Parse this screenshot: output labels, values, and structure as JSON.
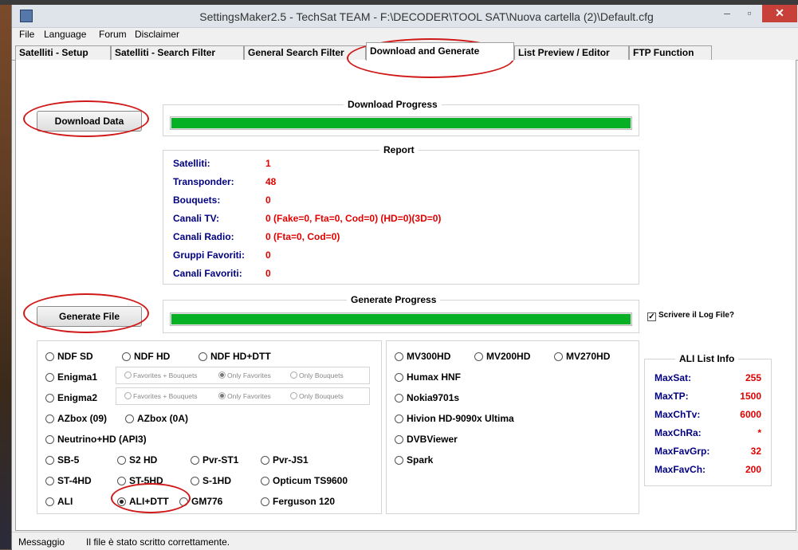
{
  "window": {
    "title": "SettingsMaker2.5 - TechSat TEAM - F:\\DECODER\\TOOL SAT\\Nuova cartella (2)\\Default.cfg",
    "minimize": "–",
    "maximize": "▫",
    "close": "✕"
  },
  "menu": [
    "File",
    "Language",
    "Forum",
    "Disclaimer"
  ],
  "tabs": [
    "Satelliti - Setup",
    "Satelliti - Search Filter",
    "General Search Filter",
    "Download and Generate",
    "List Preview / Editor",
    "FTP Function"
  ],
  "download": {
    "button": "Download Data",
    "progress_title": "Download Progress",
    "progress": 1.0
  },
  "report": {
    "title": "Report",
    "rows": [
      {
        "label": "Satelliti:",
        "value": "1"
      },
      {
        "label": "Transponder:",
        "value": "48"
      },
      {
        "label": "Bouquets:",
        "value": "0"
      },
      {
        "label": "Canali TV:",
        "value": "0 (Fake=0, Fta=0, Cod=0) (HD=0)(3D=0)"
      },
      {
        "label": "Canali Radio:",
        "value": "0 (Fta=0, Cod=0)"
      },
      {
        "label": "Gruppi Favoriti:",
        "value": "0"
      },
      {
        "label": "Canali Favoriti:",
        "value": "0"
      }
    ]
  },
  "generate": {
    "button": "Generate File",
    "progress_title": "Generate Progress",
    "progress": 1.0,
    "log_checkbox": "Scrivere il Log File?",
    "log_checked": "✓"
  },
  "formats": {
    "ndf_sd": "NDF SD",
    "ndf_hd": "NDF HD",
    "ndf_hd_dtt": "NDF HD+DTT",
    "enigma1": "Enigma1",
    "enigma2": "Enigma2",
    "sub_options": [
      "Favorites + Bouquets",
      "Only Favorites",
      "Only Bouquets"
    ],
    "azbox09": "AZbox (09)",
    "azbox0a": "AZbox (0A)",
    "neutrino": "Neutrino+HD (API3)",
    "sb5": "SB-5",
    "s2hd": "S2 HD",
    "pvrst1": "Pvr-ST1",
    "pvrjs1": "Pvr-JS1",
    "st4hd": "ST-4HD",
    "st5hd": "ST-5HD",
    "s1hd": "S-1HD",
    "opticum": "Opticum TS9600",
    "ali": "ALI",
    "ali_dtt": "ALI+DTT",
    "gm776": "GM776",
    "ferguson": "Ferguson 120",
    "mv300": "MV300HD",
    "mv200": "MV200HD",
    "mv270": "MV270HD",
    "humax": "Humax HNF",
    "nokia": "Nokia9701s",
    "hivion": "Hivion HD-9090x Ultima",
    "dvbviewer": "DVBViewer",
    "spark": "Spark"
  },
  "ali_info": {
    "title": "ALI List Info",
    "rows": [
      {
        "label": "MaxSat:",
        "value": "255"
      },
      {
        "label": "MaxTP:",
        "value": "1500"
      },
      {
        "label": "MaxChTv:",
        "value": "6000"
      },
      {
        "label": "MaxChRa:",
        "value": "*"
      },
      {
        "label": "MaxFavGrp:",
        "value": "32"
      },
      {
        "label": "MaxFavCh:",
        "value": "200"
      }
    ]
  },
  "status": {
    "label": "Messaggio",
    "text": "Il file è stato scritto correttamente."
  },
  "colors": {
    "progress": "#06b025",
    "report_label": "#000080",
    "report_value": "#e00000",
    "annotation": "#d01818",
    "close_button": "#c7413a"
  }
}
